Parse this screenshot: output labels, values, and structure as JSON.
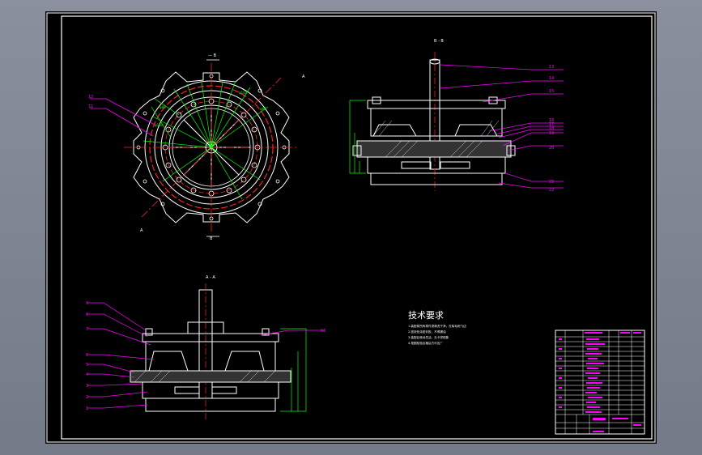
{
  "drawing": {
    "views": {
      "top_label": "— B",
      "section_bb_label": "B - B",
      "section_aa_label": "A - A",
      "section_marks": [
        "A",
        "A",
        "B"
      ]
    },
    "tech_requirements": {
      "title": "技术要求",
      "lines": [
        "1.装配前所有零件须清洗干净，去除毛刺飞边",
        "2.密封处涂密封胶，不得漏油",
        "3.装配后转动灵活，无卡滞现象",
        "4.按图检验合格后方可出厂"
      ]
    },
    "callouts_bb": [
      "13",
      "14",
      "15",
      "16",
      "17",
      "18",
      "19",
      "20",
      "21",
      "22"
    ],
    "callouts_aa_left": [
      "9",
      "8",
      "7",
      "6",
      "5",
      "4",
      "3",
      "2",
      "1"
    ],
    "callout_aa_right": "16",
    "callouts_top": [
      "12",
      "11"
    ],
    "colors": {
      "paper": "#000000",
      "outline": "#ffffff",
      "center": "#ff2020",
      "dimension": "#00ff00",
      "leader": "#ff00ff",
      "hatch": "#ffffff"
    }
  }
}
